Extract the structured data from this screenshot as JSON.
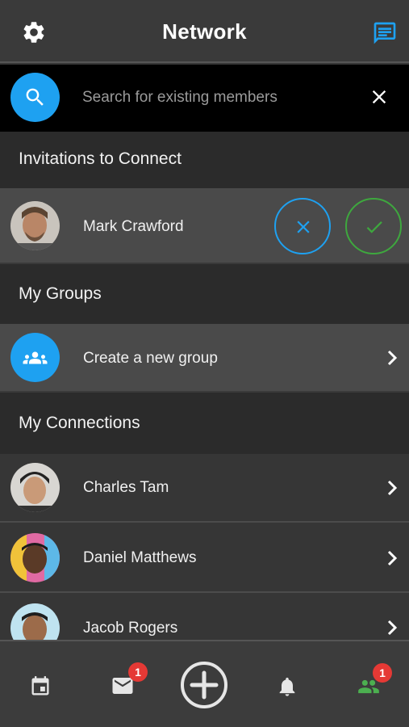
{
  "header": {
    "title": "Network",
    "settings_icon": "gear-icon",
    "chat_icon": "chat-icon"
  },
  "search": {
    "placeholder": "Search for existing members"
  },
  "sections": {
    "invitations": "Invitations to Connect",
    "groups": "My Groups",
    "connections": "My Connections"
  },
  "invitation": {
    "name": "Mark Crawford"
  },
  "groups": {
    "create_label": "Create a new group"
  },
  "connections": [
    {
      "name": "Charles Tam"
    },
    {
      "name": "Daniel Matthews"
    },
    {
      "name": "Jacob Rogers"
    }
  ],
  "tabbar": {
    "messages_badge": "1",
    "network_badge": "1"
  },
  "colors": {
    "accent_blue": "#1ea1f1",
    "accept_green": "#3ea83e",
    "badge_red": "#e53935",
    "active_tab_green": "#4caf50"
  }
}
